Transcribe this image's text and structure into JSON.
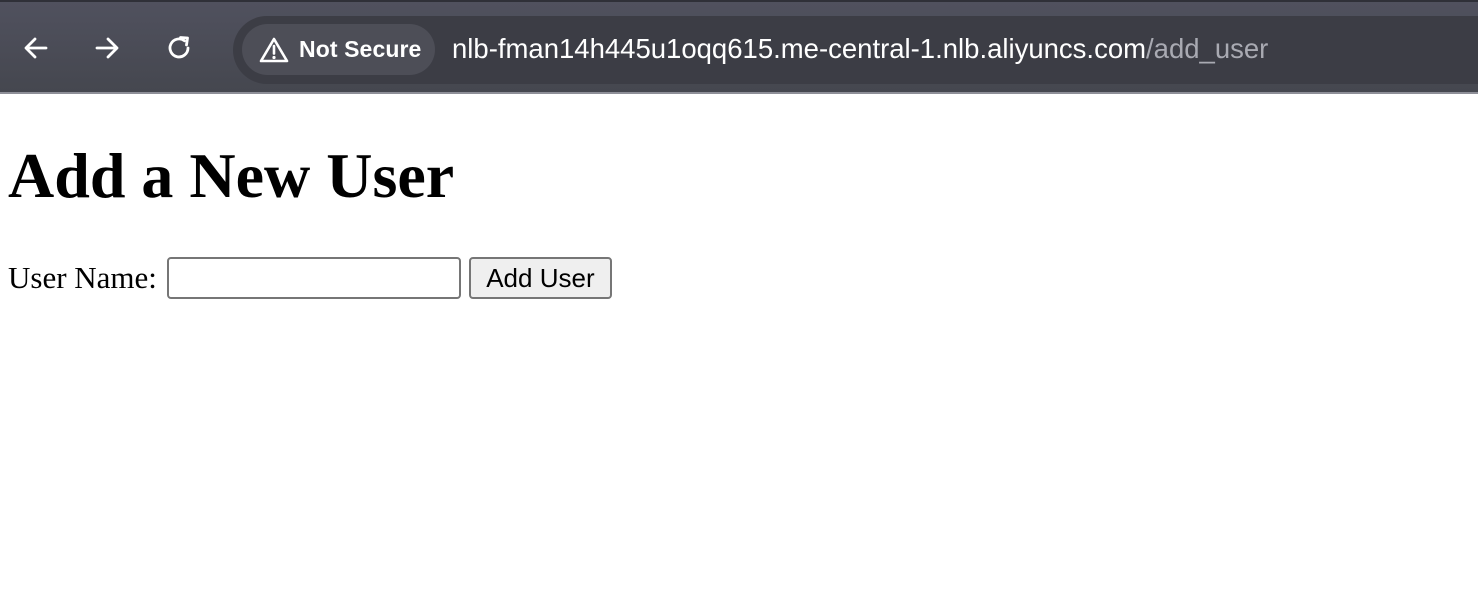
{
  "browser": {
    "nav_buttons": [
      "arrow-left-icon",
      "arrow-right-icon",
      "reload-icon"
    ],
    "security_icon": "warning-triangle-icon",
    "security_label": "Not Secure",
    "url_host": "nlb-fman14h445u1oqq615.me-central-1.nlb.aliyuncs.com",
    "url_path": "/add_user",
    "colors": {
      "toolbar": "#4a4b55",
      "omnibox": "#3c3d45",
      "chip": "#4d4e57",
      "url_path": "#a9aab2"
    }
  },
  "page": {
    "title": "Add a New User",
    "form": {
      "label": "User Name:",
      "input_value": "",
      "submit_label": "Add User"
    }
  }
}
